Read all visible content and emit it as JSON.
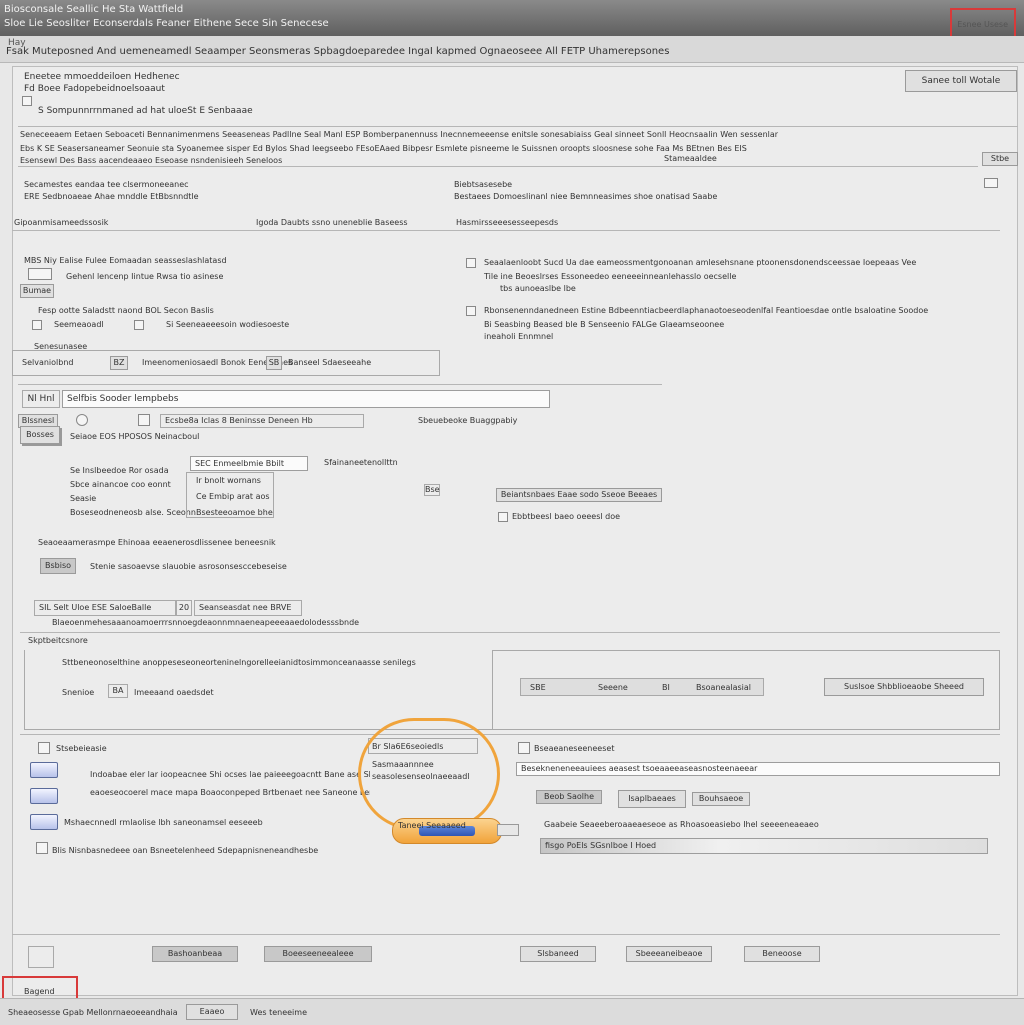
{
  "window": {
    "title": "Biosconsale Seallic He Sta Wattfield",
    "subtitle": "Sloe Lie Seosliter Econserdals Feaner Eithene Sece Sin Senecese",
    "close_label": "Esnee Usese"
  },
  "menubar": {
    "crumb": "Hay",
    "path": "Fsak Muteposned And uemeneamedl Seaamper Seonsmeras Spbagdoeparedee IngaI kapmed Ognaeoseee All FETP Uhamerepsones"
  },
  "header": {
    "line1": "Eneetee mmoeddeiloen Hedhenec",
    "line2": "Fd Boee Fadopebeidnoelsoaaut",
    "line3": "S Sompunnrrnmaned ad hat uloeSt E Senbaaae",
    "top_right_button": "Sanee toll Wotale"
  },
  "banner": {
    "row1": "Seneceeaem Eetaen Seboaceti Bennanimenmens Seeaseneas Padllne Seal Manl ESP Bomberpanennuss Inecnnemeeense enitsle sonesabiaiss Geal sinneet Sonll Heocnsaalin Wen sessenlar",
    "row2": "Ebs K SE Seasersaneamer Seonuie sta Syoanemee sisper Ed Bylos Shad leegseebo FEsoEAaed Bibpesr Esmlete pisneeme Ie Suissnen oroopts sloosnese sohe Faa Ms BEtnen Bes EIS",
    "row3": "Esensewl Des Bass aacendeaaeo Eseoase nsndenisieeh Seneloos",
    "row3_right": "Stameaaldee",
    "right_tab": "Stbe"
  },
  "section1": {
    "left_heading": "Secamestes eandaa tee clsermoneeanec",
    "left_sub": "ERE Sedbnoaeae Ahae mnddle EtBbsnndtle",
    "right_heading": "Biebtsasesebe",
    "right_sub": "Bestaees Domoeslinanl niee Bemnneasimes shoe onatisad Saabe",
    "label_a": "Gipoanmisameedssosik",
    "label_b": "Igoda Daubts ssno uneneblie Baseess",
    "label_c": "Hasmirsseeesesseepesds"
  },
  "options": {
    "opt1_title": "MBS Niy Ealise Fulee Eomaadan seasseslashlatasd",
    "opt1_sub": "Gehenl lencenp Iintue Rwsa tio asinese",
    "opt1_tag": "Bumae",
    "opt2_title": "Seaalaenloobt Sucd Ua dae eameossmentgonoanan amlesehsnane ptoonensdonendsceessae Ioepeaas Vee",
    "opt2_line2": "Tile ine Beoeslrses Essoneedeo eeneeeinneanlehasslo oecselle",
    "opt2_line3": "tbs aunoeaslbe lbe",
    "opt3_title": "Fesp ootte Saladstt naond BOL Secon Baslis",
    "opt3_left": "Seemeaoadl",
    "opt3_mid": "Si Seeneaeeesoin wodiesoeste",
    "opt4_title": "Rbonsenenndanedneen Estine Bdbeenntiacbeerdlaphanaotoeseodenlfal Feantioesdae ontle bsaloatine Soodoe",
    "opt4_line2": "Bi Seasbing Beased ble B Senseenio FALGe Glaeamseoonee",
    "opt4_line3": "ineaholi Ennmnel",
    "misc_label": "Senesunasee",
    "field_row_left": "Selvaniolbnd",
    "field_row_value": "BZ",
    "field_row_mid": "Imeenomeniosaedl Bonok Eenepaaes",
    "field_row_tag": "SB",
    "field_row_right": "Banseel Sdaeseeahe"
  },
  "search": {
    "prefix": "Nl Hnl",
    "value": "Selfbis Sooder lempbebs"
  },
  "device": {
    "tab1": "Blssnesl",
    "tab2": "Bosses",
    "row_label": "Seiaoe EOS HPOSOS Neinacboul",
    "mid_label": "Ecsbe8a Iclas 8 Beninsse Deneen Hb",
    "right_label": "Sbeuebeoke Buaggpabiy",
    "field1_label": "Se Inslbeedoe Ror osada",
    "field2_label": "Sbce ainancoe coo eonnt",
    "field3_label": "Seasie",
    "field4_label": "Boseseodneneosb alse. Sceonn",
    "select_value": "SEC Enmeelbmie Bbilt",
    "select_right": "Sfainaneetenollttn",
    "field2_value": "Ir bnolt wornans",
    "field3_value": "Ce Embip arat aos",
    "field4_value": "Bsesteeoamoe bhe",
    "side_chip": "Bse",
    "right_field": "Beiantsnbaes Eaae sodo Sseoe Beeaes",
    "right_field2": "Ebbtbeesl baeo oeeesl doe"
  },
  "storage": {
    "heading": "Seaoeaamerasmpe Ehinoaa eeaenerosdlissenee beneesnik",
    "btn": "Bsbiso",
    "desc": "Stenie sasoaevse slauobie asrosonsesccebeseise",
    "tag1": "SIL Selt Uloe ESE SaloeBalle",
    "tag1_num": "20",
    "tag2": "Seanseasdat nee BRVE",
    "desc2": "Blaeoenmehesaaanoamoerrrsnnoegdeaonnmnaeneapeeeaaedolodesssbnde"
  },
  "settings": {
    "heading": "Skptbeitcsnore",
    "line1": "Sttbeneonoselthine anoppeseseoneorteninelngorelleeianidtosimmonceanaasse senilegs",
    "line2_label": "Snenioe",
    "line2_value": "BA",
    "line2_right": "Imeeaand oaedsdet",
    "right_tab1": "SBE",
    "right_tab2": "Seeene",
    "right_tab3": "BI",
    "right_tab4": "Bsoanealasial",
    "right_btn": "Suslsoe Shbblioeaobe Sheeed"
  },
  "connect": {
    "chk1": "Stsebeieasie",
    "icon1_text": "Indoabae eler lar ioopeacnee Shi ocses lae paieeegoacntt Bane ase Shane",
    "icon2_text": "eaoeseocoerel mace mapa Boaoconpeped Brtbenaet nee Saneone Lerlls sshpe",
    "icon3_text": "Mshaecnnedl rmlaolise lbh saneonamsel eeseeeb",
    "icon4_text": "Blis Nisnbasnedeee oan Bsneetelenheed Sdepapnisneneandhesbe",
    "callout_title": "Br Sla6E6seoiedls",
    "callout_l1": "Sasmaaannnee",
    "callout_l2": "seasolesenseolnaeeaadl",
    "cable_label": "Taneei Seeaaeed",
    "chk2": "Bseaeaneseeneeset",
    "right_input": "Besekneneneeauiees aeasest tsoeaaeeaseasnosteenaeear",
    "right_btn1": "Beob Saolhe",
    "right_btn2": "Isaplbaeaes",
    "right_btn3": "Bouhsaeoe",
    "right_note": "Gaabeie Seaeeberoaaeaeseoe as Rhoasoeasiebo Ihel seeeeneaeaeo",
    "right_bar_text": "fisgo PoEls SGsnlboe I Hoed"
  },
  "footer": {
    "btn_a": "Bashoanbeaa",
    "btn_b": "Boeeseeneealeee",
    "btn_c": "Slsbaneed",
    "btn_d": "Sbeeeaneibeaoe",
    "btn_e": "Beneoose",
    "help_label": "Bagend"
  },
  "status": {
    "left": "Sheaeosesse Gpab Mellonrnaeoeeandhaia",
    "tag": "Eaaeo",
    "right": "Wes teneeime"
  }
}
